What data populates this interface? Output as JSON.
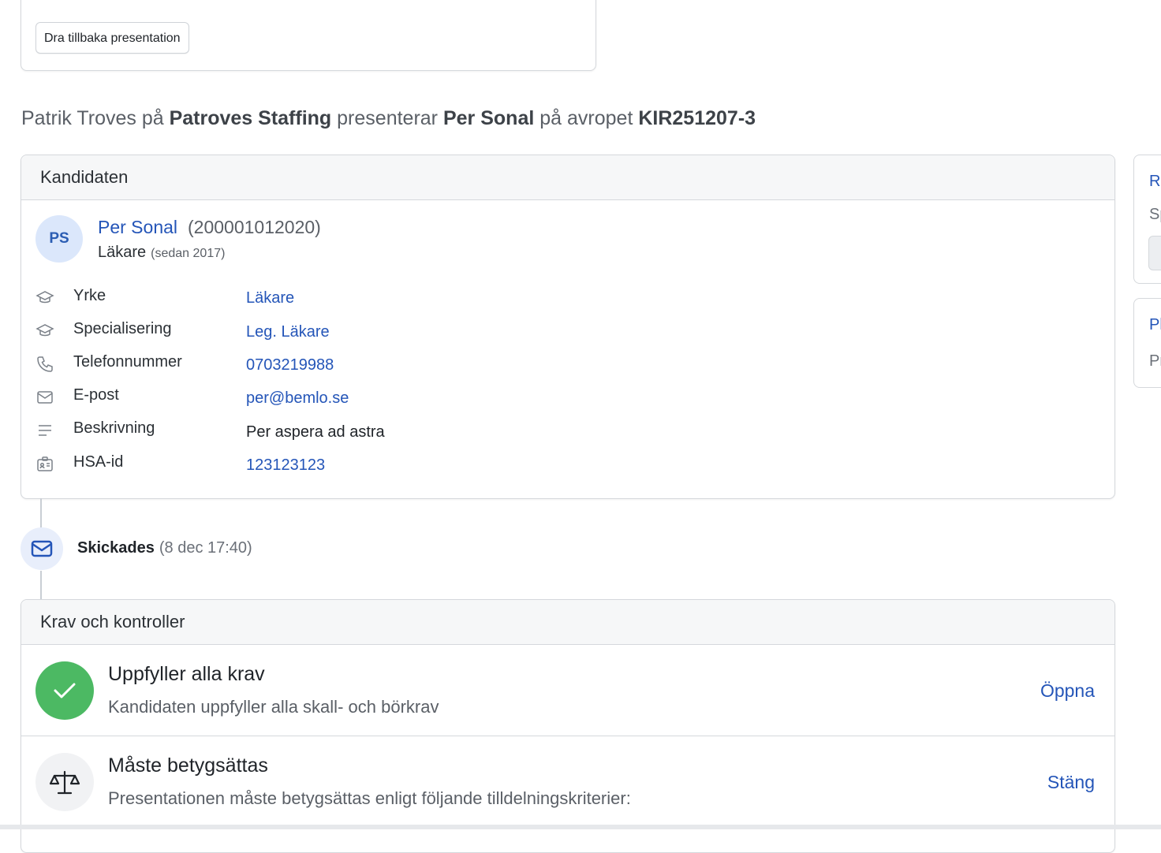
{
  "top_card": {
    "retract_button": "Dra tillbaka presentation"
  },
  "headline": {
    "sender": "Patrik Troves",
    "on": "på",
    "agency": "Patroves Staffing",
    "presents": "presenterar",
    "candidate": "Per Sonal",
    "on_order": "på avropet",
    "order_id": "KIR251207-3"
  },
  "candidate_card": {
    "title": "Kandidaten",
    "avatar_initials": "PS",
    "name": "Per Sonal",
    "personal_number": "(200001012020)",
    "role": "Läkare",
    "since": "(sedan 2017)",
    "rows": [
      {
        "icon": "graduation-cap-icon",
        "label": "Yrke",
        "value": "Läkare"
      },
      {
        "icon": "graduation-cap-icon",
        "label": "Specialisering",
        "value": "Leg. Läkare"
      },
      {
        "icon": "phone-icon",
        "label": "Telefonnummer",
        "value": "0703219988"
      },
      {
        "icon": "mail-icon",
        "label": "E-post",
        "value": "per@bemlo.se"
      },
      {
        "icon": "text-lines-icon",
        "label": "Beskrivning",
        "value": "Per aspera ad astra"
      },
      {
        "icon": "id-card-icon",
        "label": "HSA-id",
        "value": "123123123"
      }
    ]
  },
  "timeline": {
    "sent_label": "Skickades",
    "sent_time": "(8 dec 17:40)",
    "icon": "mail-icon"
  },
  "requirements_card": {
    "title": "Krav och kontroller",
    "items": [
      {
        "icon": "check-icon",
        "title": "Uppfyller alla krav",
        "description": "Kandidaten uppfyller alla skall- och börkrav",
        "action": "Öppna",
        "icon_color": "#4cb963"
      },
      {
        "icon": "scale-icon",
        "title": "Måste betygsättas",
        "description": "Presentationen måste betygsättas enligt följande tilldelningskriterier:",
        "action": "Stäng",
        "icon_color": "#f1f2f4"
      }
    ]
  },
  "side_cards": [
    {
      "title": "R",
      "text": "Sp"
    },
    {
      "title": "Pl",
      "text": "Pr"
    }
  ],
  "colors": {
    "link": "#2455b8",
    "success": "#4cb963",
    "border": "#d5d8dc"
  }
}
